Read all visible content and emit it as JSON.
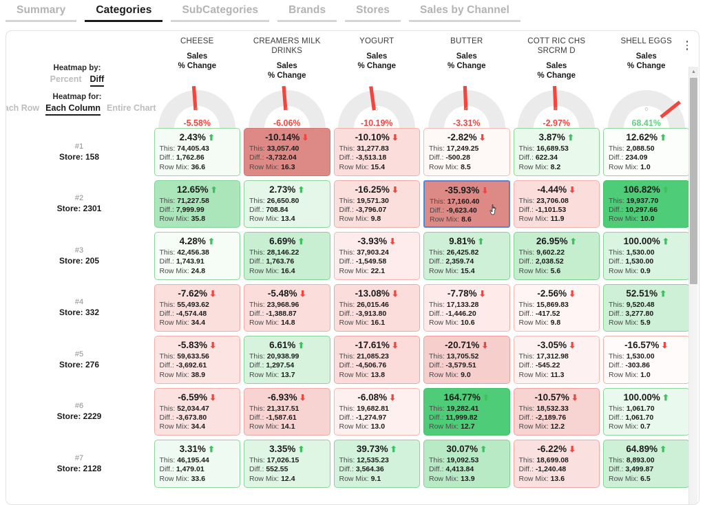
{
  "tabs": [
    {
      "label": "Summary",
      "active": false
    },
    {
      "label": "Categories",
      "active": true
    },
    {
      "label": "SubCategories",
      "active": false
    },
    {
      "label": "Brands",
      "active": false
    },
    {
      "label": "Stores",
      "active": false
    },
    {
      "label": "Sales by Channel",
      "active": false
    }
  ],
  "controls": {
    "heatmap_by_label": "Heatmap by:",
    "heatmap_by_options": [
      "Percent",
      "Diff"
    ],
    "heatmap_by_selected": "Diff",
    "heatmap_for_label": "Heatmap for:",
    "heatmap_for_options": [
      "Each Row",
      "Each Column",
      "Entire Chart"
    ],
    "heatmap_for_selected": "Each Column"
  },
  "icons": {
    "kebab": "vertical-ellipsis",
    "scroll_up": "▲",
    "up_arrow": "⬆",
    "down_arrow": "⬇"
  },
  "colors": {
    "positive": "#3fbf5f",
    "negative": "#f2453d",
    "gauge_track": "#ebebeb",
    "gauge_needle": "#f2453d",
    "gauge_fill_positive": "#4dc37a",
    "selection": "#4f86d6"
  },
  "columns": [
    {
      "name": "CHEESE",
      "metric_line1": "Sales",
      "metric_line2": "% Change",
      "gauge_value": "-5.58%",
      "gauge_pct": -5.58,
      "gauge_zero_label": "0"
    },
    {
      "name": "CREAMERS MILK DRINKS",
      "metric_line1": "Sales",
      "metric_line2": "% Change",
      "gauge_value": "-6.06%",
      "gauge_pct": -6.06,
      "gauge_zero_label": "0"
    },
    {
      "name": "YOGURT",
      "metric_line1": "Sales",
      "metric_line2": "% Change",
      "gauge_value": "-10.19%",
      "gauge_pct": -10.19,
      "gauge_zero_label": "0"
    },
    {
      "name": "BUTTER",
      "metric_line1": "Sales",
      "metric_line2": "% Change",
      "gauge_value": "-3.31%",
      "gauge_pct": -3.31,
      "gauge_zero_label": "0"
    },
    {
      "name": "COTT RIC CHS SRCRM D",
      "metric_line1": "Sales",
      "metric_line2": "% Change",
      "gauge_value": "-2.97%",
      "gauge_pct": -2.97,
      "gauge_zero_label": "0"
    },
    {
      "name": "SHELL EGGS",
      "metric_line1": "Sales",
      "metric_line2": "% Change",
      "gauge_value": "68.41%",
      "gauge_pct": 68.41,
      "gauge_zero_label": "0"
    }
  ],
  "cell_labels": {
    "this": "This:",
    "diff": "Diff.:",
    "rowmix": "Row Mix:"
  },
  "rows": [
    {
      "rank": "#1",
      "store": "Store: 158",
      "cells": [
        {
          "pct": "2.43%",
          "dir": "up",
          "this": "74,405.43",
          "diff": "1,762.86",
          "rowmix": "36.6",
          "bg": "#f4fcf5",
          "border": "#96d79f",
          "selected": false
        },
        {
          "pct": "-10.14%",
          "dir": "down",
          "this": "33,057.40",
          "diff": "-3,732.04",
          "rowmix": "16.3",
          "bg": "#dd8a87",
          "border": "#d1746f",
          "selected": false
        },
        {
          "pct": "-10.10%",
          "dir": "down",
          "this": "31,277.83",
          "diff": "-3,513.18",
          "rowmix": "15.4",
          "bg": "#fbdedc",
          "border": "#f2b0ab",
          "selected": false
        },
        {
          "pct": "-2.82%",
          "dir": "down",
          "this": "17,249.25",
          "diff": "-500.28",
          "rowmix": "8.5",
          "bg": "#fef8f7",
          "border": "#f5b9b4",
          "selected": false
        },
        {
          "pct": "3.87%",
          "dir": "up",
          "this": "16,689.53",
          "diff": "622.34",
          "rowmix": "8.2",
          "bg": "#e9f9ec",
          "border": "#8ed49b",
          "selected": false
        },
        {
          "pct": "12.62%",
          "dir": "up",
          "this": "2,088.50",
          "diff": "234.09",
          "rowmix": "1.0",
          "bg": "#fbfefb",
          "border": "#8fd49b",
          "selected": false
        }
      ]
    },
    {
      "rank": "#2",
      "store": "Store: 2301",
      "cells": [
        {
          "pct": "12.65%",
          "dir": "up",
          "this": "71,227.58",
          "diff": "7,999.99",
          "rowmix": "35.8",
          "bg": "#abe6ba",
          "border": "#7fd294",
          "selected": false
        },
        {
          "pct": "2.73%",
          "dir": "up",
          "this": "26,650.80",
          "diff": "708.84",
          "rowmix": "13.4",
          "bg": "#e5f7e9",
          "border": "#8ed49b",
          "selected": false
        },
        {
          "pct": "-16.25%",
          "dir": "down",
          "this": "19,571.30",
          "diff": "-3,796.07",
          "rowmix": "9.8",
          "bg": "#fbdfdd",
          "border": "#f0aaa5",
          "selected": false
        },
        {
          "pct": "-35.93%",
          "dir": "down",
          "this": "17,160.40",
          "diff": "-9,623.40",
          "rowmix": "8.6",
          "bg": "#dd8a87",
          "border": "#4f86d6",
          "selected": true
        },
        {
          "pct": "-4.44%",
          "dir": "down",
          "this": "23,706.08",
          "diff": "-1,101.53",
          "rowmix": "11.9",
          "bg": "#fbdedc",
          "border": "#f2b0ab",
          "selected": false
        },
        {
          "pct": "106.82%",
          "dir": "up",
          "this": "19,937.70",
          "diff": "10,297.66",
          "rowmix": "10.0",
          "bg": "#4fcc77",
          "border": "#3fbf66",
          "selected": false
        }
      ]
    },
    {
      "rank": "#3",
      "store": "Store: 205",
      "cells": [
        {
          "pct": "4.28%",
          "dir": "up",
          "this": "42,456.38",
          "diff": "1,743.91",
          "rowmix": "24.8",
          "bg": "#f6fdf7",
          "border": "#8fd49b",
          "selected": false
        },
        {
          "pct": "6.69%",
          "dir": "up",
          "this": "28,146.22",
          "diff": "1,763.76",
          "rowmix": "16.4",
          "bg": "#c9efd3",
          "border": "#86d395",
          "selected": false
        },
        {
          "pct": "-3.93%",
          "dir": "down",
          "this": "37,903.24",
          "diff": "-1,549.58",
          "rowmix": "22.1",
          "bg": "#fdeceb",
          "border": "#f5b4af",
          "selected": false
        },
        {
          "pct": "9.81%",
          "dir": "up",
          "this": "26,425.82",
          "diff": "2,359.74",
          "rowmix": "15.4",
          "bg": "#cdf0d6",
          "border": "#86d395",
          "selected": false
        },
        {
          "pct": "26.95%",
          "dir": "up",
          "this": "9,602.22",
          "diff": "2,038.52",
          "rowmix": "5.6",
          "bg": "#c5eecf",
          "border": "#83d192",
          "selected": false
        },
        {
          "pct": "100.00%",
          "dir": "up",
          "this": "1,530.00",
          "diff": "1,530.00",
          "rowmix": "0.9",
          "bg": "#d9f4e0",
          "border": "#88d397",
          "selected": false
        }
      ]
    },
    {
      "rank": "#4",
      "store": "Store: 332",
      "cells": [
        {
          "pct": "-7.62%",
          "dir": "down",
          "this": "55,493.62",
          "diff": "-4,574.48",
          "rowmix": "34.4",
          "bg": "#fbdfdd",
          "border": "#f0aaa5",
          "selected": false
        },
        {
          "pct": "-5.48%",
          "dir": "down",
          "this": "23,968.96",
          "diff": "-1,388.87",
          "rowmix": "14.8",
          "bg": "#fbdedc",
          "border": "#f1aca7",
          "selected": false
        },
        {
          "pct": "-13.08%",
          "dir": "down",
          "this": "26,015.46",
          "diff": "-3,913.80",
          "rowmix": "16.1",
          "bg": "#fbdddb",
          "border": "#efa7a2",
          "selected": false
        },
        {
          "pct": "-7.78%",
          "dir": "down",
          "this": "17,133.28",
          "diff": "-1,446.20",
          "rowmix": "10.6",
          "bg": "#fdeae9",
          "border": "#f3b1ac",
          "selected": false
        },
        {
          "pct": "-2.56%",
          "dir": "down",
          "this": "15,869.83",
          "diff": "-417.52",
          "rowmix": "9.8",
          "bg": "#fef5f4",
          "border": "#f5bab5",
          "selected": false
        },
        {
          "pct": "52.51%",
          "dir": "up",
          "this": "9,520.48",
          "diff": "3,277.80",
          "rowmix": "5.9",
          "bg": "#cdf0d6",
          "border": "#86d395",
          "selected": false
        }
      ]
    },
    {
      "rank": "#5",
      "store": "Store: 276",
      "cells": [
        {
          "pct": "-5.83%",
          "dir": "down",
          "this": "59,633.56",
          "diff": "-3,692.61",
          "rowmix": "38.9",
          "bg": "#fce4e2",
          "border": "#f2b0ab",
          "selected": false
        },
        {
          "pct": "6.61%",
          "dir": "up",
          "this": "20,938.99",
          "diff": "1,297.54",
          "rowmix": "13.7",
          "bg": "#d7f3de",
          "border": "#89d398",
          "selected": false
        },
        {
          "pct": "-17.61%",
          "dir": "down",
          "this": "21,085.23",
          "diff": "-4,506.76",
          "rowmix": "13.8",
          "bg": "#fbdcda",
          "border": "#eea5a0",
          "selected": false
        },
        {
          "pct": "-20.71%",
          "dir": "down",
          "this": "13,705.52",
          "diff": "-3,579.51",
          "rowmix": "9.0",
          "bg": "#f6cfcd",
          "border": "#eda09b",
          "selected": false
        },
        {
          "pct": "-3.05%",
          "dir": "down",
          "this": "17,312.98",
          "diff": "-545.22",
          "rowmix": "11.3",
          "bg": "#fdf2f1",
          "border": "#f5b9b4",
          "selected": false
        },
        {
          "pct": "-16.57%",
          "dir": "down",
          "this": "1,530.00",
          "diff": "-303.86",
          "rowmix": "1.0",
          "bg": "#fefbfa",
          "border": "#f2b0ab",
          "selected": false
        }
      ]
    },
    {
      "rank": "#6",
      "store": "Store: 2229",
      "cells": [
        {
          "pct": "-6.59%",
          "dir": "down",
          "this": "52,034.47",
          "diff": "-3,673.80",
          "rowmix": "34.4",
          "bg": "#fbe2e0",
          "border": "#f1aea9",
          "selected": false
        },
        {
          "pct": "-6.93%",
          "dir": "down",
          "this": "21,317.51",
          "diff": "-1,587.61",
          "rowmix": "14.1",
          "bg": "#f7d4d2",
          "border": "#eea7a2",
          "selected": false
        },
        {
          "pct": "-6.08%",
          "dir": "down",
          "this": "19,682.81",
          "diff": "-1,274.97",
          "rowmix": "13.0",
          "bg": "#fdf0ef",
          "border": "#f4b6b1",
          "selected": false
        },
        {
          "pct": "164.77%",
          "dir": "up",
          "this": "19,282.41",
          "diff": "11,999.82",
          "rowmix": "12.7",
          "bg": "#4fcc77",
          "border": "#3fbf66",
          "selected": false
        },
        {
          "pct": "-10.57%",
          "dir": "down",
          "this": "18,532.33",
          "diff": "-2,189.76",
          "rowmix": "12.2",
          "bg": "#f7d3d1",
          "border": "#eda39e",
          "selected": false
        },
        {
          "pct": "100.00%",
          "dir": "up",
          "this": "1,061.70",
          "diff": "1,061.70",
          "rowmix": "0.7",
          "bg": "#e9f9ed",
          "border": "#8ed49b",
          "selected": false
        }
      ]
    },
    {
      "rank": "#7",
      "store": "Store: 2128",
      "cells": [
        {
          "pct": "3.31%",
          "dir": "up",
          "this": "46,195.44",
          "diff": "1,479.01",
          "rowmix": "33.6",
          "bg": "#effbf2",
          "border": "#8fd49b",
          "selected": false
        },
        {
          "pct": "3.35%",
          "dir": "up",
          "this": "17,026.15",
          "diff": "552.55",
          "rowmix": "12.4",
          "bg": "#dff6e5",
          "border": "#8bd399",
          "selected": false
        },
        {
          "pct": "39.73%",
          "dir": "up",
          "this": "12,535.23",
          "diff": "3,564.36",
          "rowmix": "9.1",
          "bg": "#d3f2db",
          "border": "#88d397",
          "selected": false
        },
        {
          "pct": "30.07%",
          "dir": "up",
          "this": "19,092.53",
          "diff": "4,413.84",
          "rowmix": "13.9",
          "bg": "#b9eac6",
          "border": "#82d191",
          "selected": false
        },
        {
          "pct": "-6.22%",
          "dir": "down",
          "this": "18,699.08",
          "diff": "-1,240.48",
          "rowmix": "13.6",
          "bg": "#fae0de",
          "border": "#f0aaa5",
          "selected": false
        },
        {
          "pct": "64.89%",
          "dir": "up",
          "this": "8,893.00",
          "diff": "3,499.87",
          "rowmix": "6.5",
          "bg": "#cdf0d6",
          "border": "#86d395",
          "selected": false
        }
      ]
    }
  ]
}
